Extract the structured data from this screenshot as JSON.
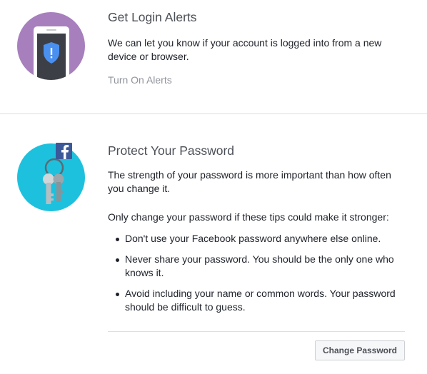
{
  "login_alerts": {
    "title": "Get Login Alerts",
    "description": "We can let you know if your account is logged into from a new device or browser.",
    "action_label": "Turn On Alerts",
    "icon": "phone-shield-icon",
    "icon_bg": "#a77fbd"
  },
  "protect_password": {
    "title": "Protect Your Password",
    "description": "The strength of your password is more important than how often you change it.",
    "tips_intro": "Only change your password if these tips could make it stronger:",
    "tips": [
      "Don't use your Facebook password anywhere else online.",
      "Never share your password. You should be the only one who knows it.",
      "Avoid including your name or common words. Your password should be difficult to guess."
    ],
    "button_label": "Change Password",
    "icon": "keys-icon",
    "icon_bg": "#1ec1dd",
    "brand_color": "#3b5998"
  }
}
